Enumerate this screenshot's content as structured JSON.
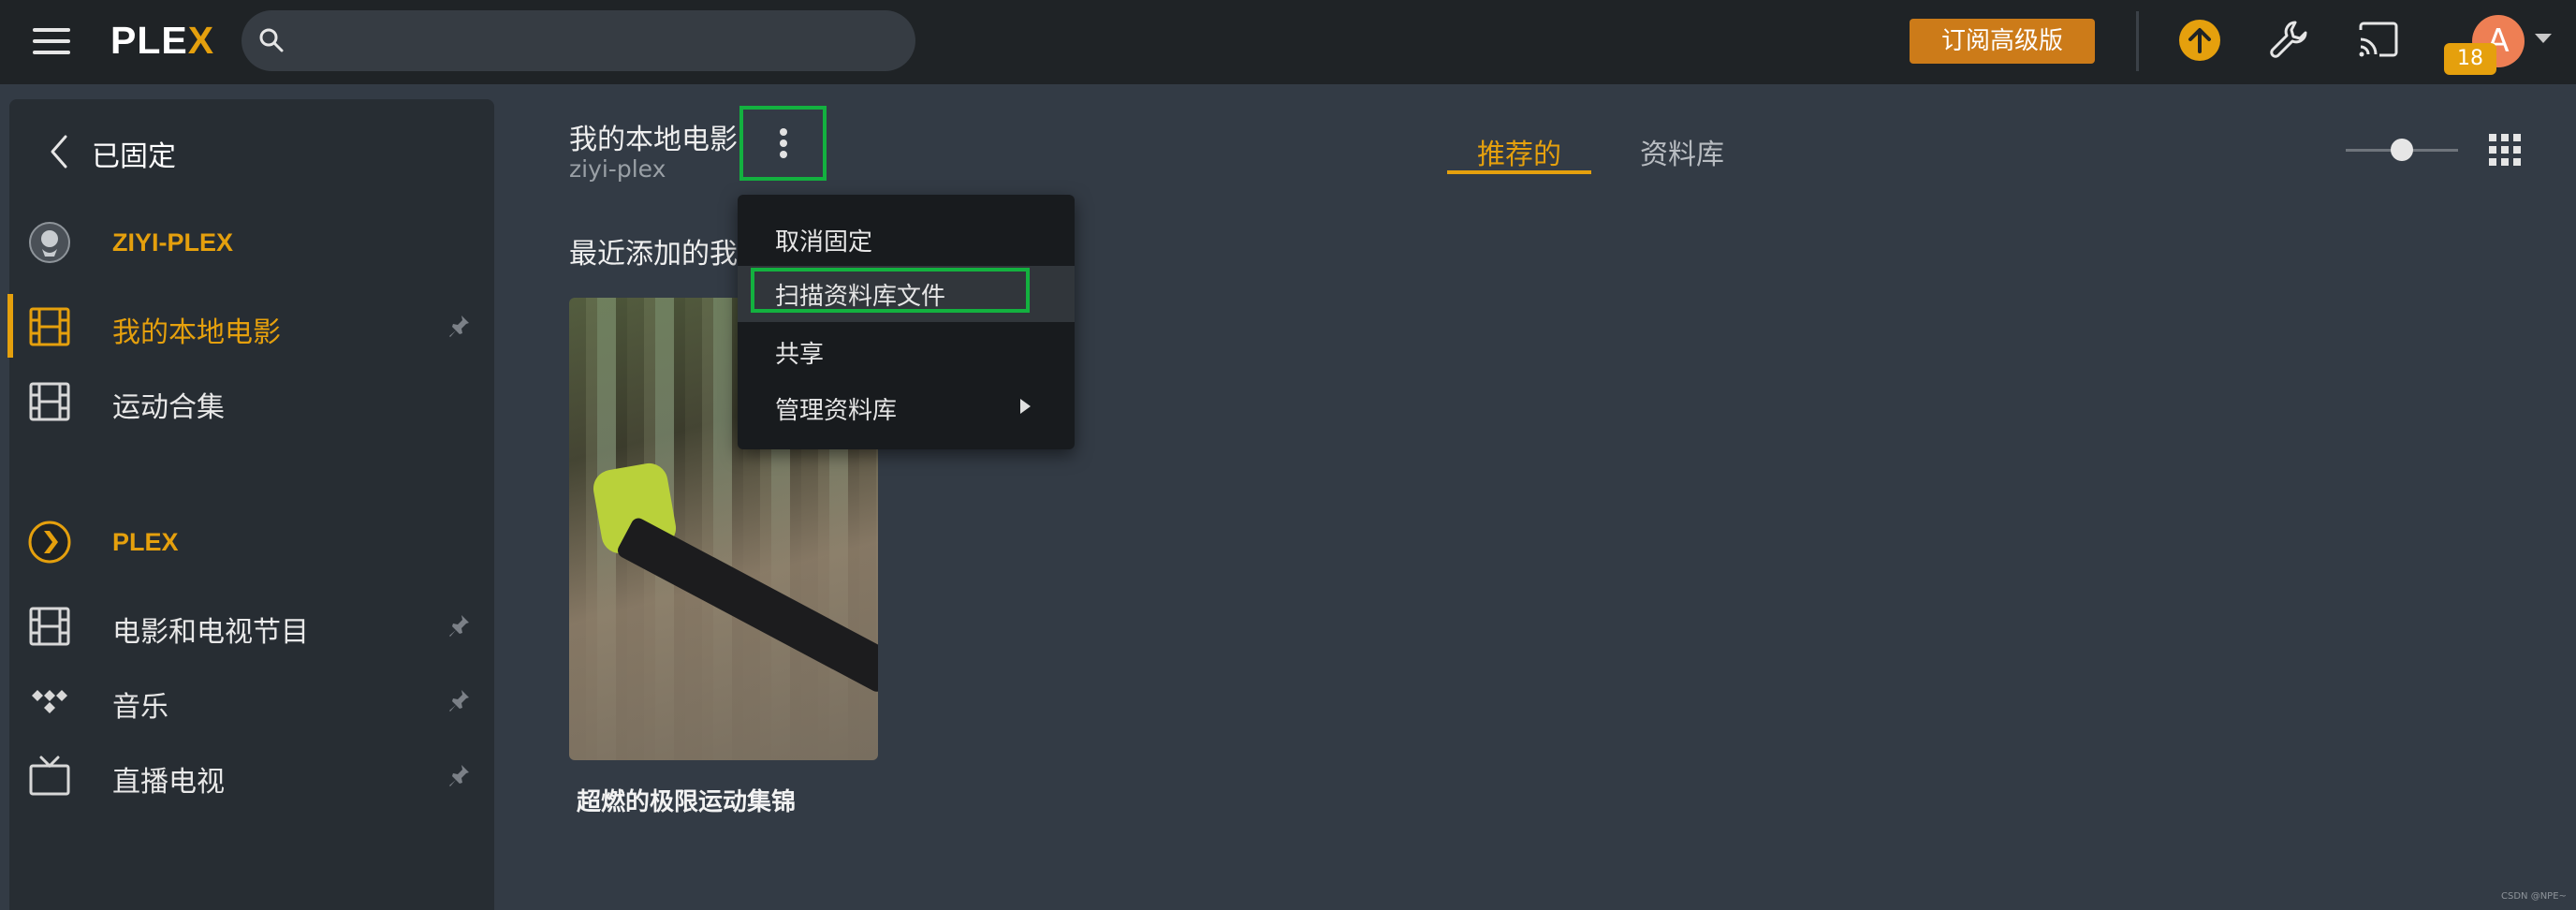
{
  "topbar": {
    "logo_text": "PLE",
    "logo_x": "X",
    "subscribe_label": "订阅高级版",
    "badge_count": "18",
    "avatar_initial": "A"
  },
  "sidebar": {
    "back_label": "已固定",
    "items": [
      {
        "label": "ZIYI-PLEX",
        "icon": "server-avatar-icon"
      },
      {
        "label": "我的本地电影",
        "icon": "film-icon",
        "pinned": true,
        "active": true
      },
      {
        "label": "运动合集",
        "icon": "film-icon"
      },
      {
        "label": "PLEX",
        "icon": "plex-chevron-icon"
      },
      {
        "label": "电影和电视节目",
        "icon": "film-icon",
        "pinned": true
      },
      {
        "label": "音乐",
        "icon": "tidal-icon",
        "pinned": true
      },
      {
        "label": "直播电视",
        "icon": "tv-icon",
        "pinned": true
      }
    ]
  },
  "main": {
    "library_title": "我的本地电影",
    "library_subtitle": "ziyi-plex",
    "tabs": [
      "推荐的",
      "资料库"
    ],
    "active_tab": "推荐的",
    "section_title": "最近添加的我",
    "poster_title": "超燃的极限运动集锦"
  },
  "menu": {
    "items": [
      "取消固定",
      "扫描资料库文件",
      "共享",
      "管理资料库"
    ],
    "highlighted": "扫描资料库文件"
  },
  "colors": {
    "accent": "#e5a00d",
    "highlight_box": "#13b13f",
    "topbar_bg": "#1f2326",
    "sidebar_bg": "#272d33",
    "main_bg": "#333b45"
  },
  "watermark": "CSDN @NPE~"
}
